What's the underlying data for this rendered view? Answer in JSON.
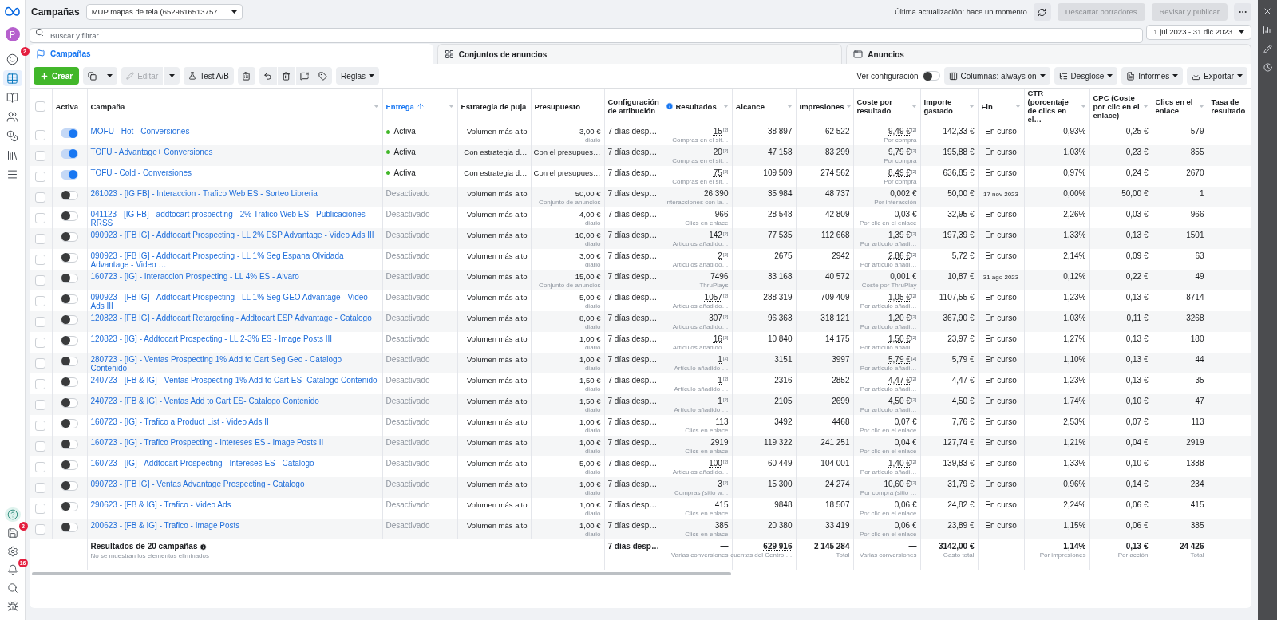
{
  "sidebar": {
    "avatar": "P",
    "items": [
      {
        "badge": "2",
        "selected": false
      },
      {
        "selected": true
      },
      {
        "selected": false
      },
      {
        "selected": false
      },
      {
        "selected": false
      },
      {
        "selected": false
      },
      {
        "selected": false
      }
    ],
    "bottom_items": [
      {
        "selected": true
      },
      {
        "badge": "2",
        "selected": false
      },
      {
        "selected": false
      },
      {
        "badge": "16",
        "selected": false
      },
      {
        "selected": false
      },
      {
        "selected": false
      }
    ]
  },
  "header": {
    "title": "Campañas",
    "account": "MUP mapas de tela (6529616513757…",
    "last_update": "Última actualización: hace un momento",
    "buttons": [
      {
        "label": "Descartar borradores",
        "disabled": true
      },
      {
        "label": "Revisar y publicar",
        "disabled": true
      }
    ]
  },
  "search": {
    "placeholder": "Buscar y filtrar"
  },
  "date_range": "1 jul 2023 - 31 dic 2023",
  "tabs": [
    {
      "label": "Campañas",
      "selected": true
    },
    {
      "label": "Conjuntos de anuncios",
      "selected": false
    },
    {
      "label": "Anuncios",
      "selected": false
    }
  ],
  "toolbar": {
    "create": "Crear",
    "edit": {
      "label": "Editar",
      "disabled": true
    },
    "ab_test": "Test A/B",
    "rules": "Reglas",
    "view_setup": "Ver configuración",
    "view_setup_on": false,
    "columns": "Columnas: always on",
    "breakdown": "Desglose",
    "reports": "Informes",
    "export": "Exportar"
  },
  "table": {
    "select_all_checked": false,
    "columns": [
      {
        "label": "Activa",
        "menu": false
      },
      {
        "label": "Campaña",
        "menu": true
      },
      {
        "label": "Entrega",
        "menu": true,
        "sorted": true
      },
      {
        "label": "Estrategia de puja",
        "menu": false
      },
      {
        "label": "Presupuesto",
        "menu": false
      },
      {
        "label": "Configuración de atribución",
        "menu": false
      },
      {
        "label": "Resultados",
        "menu": true,
        "info": true
      },
      {
        "label": "Alcance",
        "menu": true
      },
      {
        "label": "Impresiones",
        "menu": true
      },
      {
        "label": "Coste por resultado",
        "menu": true
      },
      {
        "label": "Importe gastado",
        "menu": true
      },
      {
        "label": "Fin",
        "menu": true
      },
      {
        "label": "CTR (porcentaje de clics en el…",
        "menu": true
      },
      {
        "label": "CPC (Coste por clic en el enlace)",
        "menu": true
      },
      {
        "label": "Clics en el enlace",
        "menu": true
      },
      {
        "label": "Tasa de resultado",
        "menu": false
      }
    ],
    "rows": [
      {
        "checked": false,
        "on": true,
        "name": "MOFU - Hot - Conversiones",
        "delivery": "Activa",
        "delivery_active": true,
        "strategy": "Volumen más alto",
        "budget": {
          "value": "3,00 €",
          "note": "diario"
        },
        "attribution": "7 días desp…",
        "results": {
          "value": "15",
          "mark": "[2]",
          "note": "Compras en el sit…"
        },
        "reach": "38 897",
        "impressions": "62 522",
        "cost": {
          "value": "9,49 €",
          "mark": "[2]",
          "note": "Por compra"
        },
        "spent": "142,33 €",
        "end": "En curso",
        "ctr": "0,93%",
        "cpc": "0,25 €",
        "clicks": "579"
      },
      {
        "checked": false,
        "on": true,
        "name": "TOFU - Advantage+ Conversiones",
        "delivery": "Activa",
        "delivery_active": true,
        "strategy": "Con estrategia d…",
        "budget": {
          "value": "Con el presupues…"
        },
        "attribution": "7 días desp…",
        "results": {
          "value": "20",
          "mark": "[2]",
          "note": "Compras en el sit…"
        },
        "reach": "47 158",
        "impressions": "83 299",
        "cost": {
          "value": "9,79 €",
          "mark": "[2]",
          "note": "Por compra"
        },
        "spent": "195,88 €",
        "end": "En curso",
        "ctr": "1,03%",
        "cpc": "0,23 €",
        "clicks": "855"
      },
      {
        "checked": false,
        "on": true,
        "name": "TOFU - Cold - Conversiones",
        "delivery": "Activa",
        "delivery_active": true,
        "strategy": "Con estrategia d…",
        "budget": {
          "value": "Con el presupues…"
        },
        "attribution": "7 días desp…",
        "results": {
          "value": "75",
          "mark": "[2]",
          "note": "Compras en el sit…"
        },
        "reach": "109 509",
        "impressions": "274 562",
        "cost": {
          "value": "8,49 €",
          "mark": "[2]",
          "note": "Por compra"
        },
        "spent": "636,85 €",
        "end": "En curso",
        "ctr": "0,97%",
        "cpc": "0,24 €",
        "clicks": "2670"
      },
      {
        "checked": false,
        "on": false,
        "name": "261023 - [IG FB] - Interaccion - Trafico Web ES - Sorteo Libreria",
        "delivery": "Desactivado",
        "delivery_active": false,
        "strategy": "Volumen más alto",
        "budget": {
          "value": "50,00 €",
          "note": "Conjunto de anuncios"
        },
        "attribution": "7 días desp…",
        "results": {
          "value": "26 390",
          "note": "Interacciones con la…"
        },
        "reach": "35 984",
        "impressions": "48 737",
        "cost": {
          "value": "0,002 €",
          "note": "Por interacción"
        },
        "spent": "50,00 €",
        "end": "17 nov 2023",
        "ctr": "0,00%",
        "cpc": "50,00 €",
        "clicks": "1"
      },
      {
        "checked": false,
        "on": false,
        "name": "041123 - [IG FB] - addtocart prospecting - 2% Trafico Web ES - Publicaciones RRSS",
        "delivery": "Desactivado",
        "delivery_active": false,
        "strategy": "Volumen más alto",
        "budget": {
          "value": "4,00 €",
          "note": "diario"
        },
        "attribution": "7 días desp…",
        "results": {
          "value": "966",
          "note": "Clics en enlace"
        },
        "reach": "28 548",
        "impressions": "42 809",
        "cost": {
          "value": "0,03 €",
          "note": "Por clic en el enlace"
        },
        "spent": "32,95 €",
        "end": "En curso",
        "ctr": "2,26%",
        "cpc": "0,03 €",
        "clicks": "966"
      },
      {
        "checked": false,
        "on": false,
        "name": "090923 - [FB IG] - Addtocart Prospecting - LL 2% ESP Advantage - Video Ads III",
        "delivery": "Desactivado",
        "delivery_active": false,
        "strategy": "Volumen más alto",
        "budget": {
          "value": "10,00 €",
          "note": "diario"
        },
        "attribution": "7 días desp…",
        "results": {
          "value": "142",
          "mark": "[2]",
          "note": "Artículos añadido…"
        },
        "reach": "77 535",
        "impressions": "112 668",
        "cost": {
          "value": "1,39 €",
          "mark": "[2]",
          "note": "Por artículo añadi…"
        },
        "spent": "197,39 €",
        "end": "En curso",
        "ctr": "1,33%",
        "cpc": "0,13 €",
        "clicks": "1501"
      },
      {
        "checked": false,
        "on": false,
        "name": "090923 - [FB IG] - Addtocart Prospecting - LL 1% Seg Espana Olvidada Advantage - Video …",
        "delivery": "Desactivado",
        "delivery_active": false,
        "strategy": "Volumen más alto",
        "budget": {
          "value": "3,00 €",
          "note": "diario"
        },
        "attribution": "7 días desp…",
        "results": {
          "value": "2",
          "mark": "[2]",
          "note": "Artículos añadido…"
        },
        "reach": "2675",
        "impressions": "2942",
        "cost": {
          "value": "2,86 €",
          "mark": "[2]",
          "note": "Por artículo añadi…"
        },
        "spent": "5,72 €",
        "end": "En curso",
        "ctr": "2,14%",
        "cpc": "0,09 €",
        "clicks": "63"
      },
      {
        "checked": false,
        "on": false,
        "name": "160723 - [IG] - Interaccion Prospecting - LL 4% ES - Alvaro",
        "delivery": "Desactivado",
        "delivery_active": false,
        "strategy": "Volumen más alto",
        "budget": {
          "value": "15,00 €",
          "note": "Conjunto de anuncios"
        },
        "attribution": "7 días desp…",
        "results": {
          "value": "7496",
          "note": "ThruPlays"
        },
        "reach": "33 168",
        "impressions": "40 572",
        "cost": {
          "value": "0,001 €",
          "note": "Coste por ThruPlay"
        },
        "spent": "10,87 €",
        "end": "31 ago 2023",
        "ctr": "0,12%",
        "cpc": "0,22 €",
        "clicks": "49"
      },
      {
        "checked": false,
        "on": false,
        "name": "090923 - [FB IG] - Addtocart Prospecting - LL 1% Seg GEO Advantage - Video Ads III",
        "delivery": "Desactivado",
        "delivery_active": false,
        "strategy": "Volumen más alto",
        "budget": {
          "value": "5,00 €",
          "note": "diario"
        },
        "attribution": "7 días desp…",
        "results": {
          "value": "1057",
          "mark": "[2]",
          "note": "Artículos añadido…"
        },
        "reach": "288 319",
        "impressions": "709 409",
        "cost": {
          "value": "1,05 €",
          "mark": "[2]",
          "note": "Por artículo añadi…"
        },
        "spent": "1107,55 €",
        "end": "En curso",
        "ctr": "1,23%",
        "cpc": "0,13 €",
        "clicks": "8714"
      },
      {
        "checked": false,
        "on": false,
        "name": "120823 - [FB IG] - Addtocart Retargeting - Addtocart ESP Advantage - Catalogo",
        "delivery": "Desactivado",
        "delivery_active": false,
        "strategy": "Volumen más alto",
        "budget": {
          "value": "8,00 €",
          "note": "diario"
        },
        "attribution": "7 días desp…",
        "results": {
          "value": "307",
          "mark": "[2]",
          "note": "Artículos añadido…"
        },
        "reach": "96 363",
        "impressions": "318 121",
        "cost": {
          "value": "1,20 €",
          "mark": "[2]",
          "note": "Por artículo añadi…"
        },
        "spent": "367,90 €",
        "end": "En curso",
        "ctr": "1,03%",
        "cpc": "0,11 €",
        "clicks": "3268"
      },
      {
        "checked": false,
        "on": false,
        "name": "120823 - [IG] - Addtocart Prospecting - LL 2-3% ES - Image Posts III",
        "delivery": "Desactivado",
        "delivery_active": false,
        "strategy": "Volumen más alto",
        "budget": {
          "value": "1,00 €",
          "note": "diario"
        },
        "attribution": "7 días desp…",
        "results": {
          "value": "16",
          "mark": "[2]",
          "note": "Artículos añadido…"
        },
        "reach": "10 840",
        "impressions": "14 175",
        "cost": {
          "value": "1,50 €",
          "mark": "[2]",
          "note": "Por artículo añadi…"
        },
        "spent": "23,97 €",
        "end": "En curso",
        "ctr": "1,27%",
        "cpc": "0,13 €",
        "clicks": "180"
      },
      {
        "checked": false,
        "on": false,
        "name": "280723 - [IG] - Ventas Prospecting 1% Add to Cart Seg Geo - Catalogo Contenido",
        "delivery": "Desactivado",
        "delivery_active": false,
        "strategy": "Volumen más alto",
        "budget": {
          "value": "1,00 €",
          "note": "diario"
        },
        "attribution": "7 días desp…",
        "results": {
          "value": "1",
          "mark": "[2]",
          "note": "Artículo añadido …"
        },
        "reach": "3151",
        "impressions": "3997",
        "cost": {
          "value": "5,79 €",
          "mark": "[2]",
          "note": "Por artículo añadi…"
        },
        "spent": "5,79 €",
        "end": "En curso",
        "ctr": "1,10%",
        "cpc": "0,13 €",
        "clicks": "44"
      },
      {
        "checked": false,
        "on": false,
        "name": "240723 - [FB & IG] - Ventas Prospecting 1% Add to Cart ES- Catalogo Contenido",
        "delivery": "Desactivado",
        "delivery_active": false,
        "strategy": "Volumen más alto",
        "budget": {
          "value": "1,50 €",
          "note": "diario"
        },
        "attribution": "7 días desp…",
        "results": {
          "value": "1",
          "mark": "[2]",
          "note": "Artículo añadido …"
        },
        "reach": "2316",
        "impressions": "2852",
        "cost": {
          "value": "4,47 €",
          "mark": "[2]",
          "note": "Por artículo añadi…"
        },
        "spent": "4,47 €",
        "end": "En curso",
        "ctr": "1,23%",
        "cpc": "0,13 €",
        "clicks": "35"
      },
      {
        "checked": false,
        "on": false,
        "name": "240723 - [FB & IG] - Ventas Add to Cart ES- Catalogo Contenido",
        "delivery": "Desactivado",
        "delivery_active": false,
        "strategy": "Volumen más alto",
        "budget": {
          "value": "1,50 €",
          "note": "diario"
        },
        "attribution": "7 días desp…",
        "results": {
          "value": "1",
          "mark": "[2]",
          "note": "Artículo añadido …"
        },
        "reach": "2105",
        "impressions": "2699",
        "cost": {
          "value": "4,50 €",
          "mark": "[2]",
          "note": "Por artículo añadi…"
        },
        "spent": "4,50 €",
        "end": "En curso",
        "ctr": "1,74%",
        "cpc": "0,10 €",
        "clicks": "47"
      },
      {
        "checked": false,
        "on": false,
        "name": "160723 - [IG] - Trafico a Product List - Video Ads II",
        "delivery": "Desactivado",
        "delivery_active": false,
        "strategy": "Volumen más alto",
        "budget": {
          "value": "1,00 €",
          "note": "diario"
        },
        "attribution": "7 días desp…",
        "results": {
          "value": "113",
          "note": "Clics en enlace"
        },
        "reach": "3492",
        "impressions": "4468",
        "cost": {
          "value": "0,07 €",
          "note": "Por clic en el enlace"
        },
        "spent": "7,76 €",
        "end": "En curso",
        "ctr": "2,53%",
        "cpc": "0,07 €",
        "clicks": "113"
      },
      {
        "checked": false,
        "on": false,
        "name": "160723 - [IG] - Trafico Prospecting - Intereses ES - Image Posts II",
        "delivery": "Desactivado",
        "delivery_active": false,
        "strategy": "Volumen más alto",
        "budget": {
          "value": "1,00 €",
          "note": "diario"
        },
        "attribution": "7 días desp…",
        "results": {
          "value": "2919",
          "note": "Clics en enlace"
        },
        "reach": "119 322",
        "impressions": "241 251",
        "cost": {
          "value": "0,04 €",
          "note": "Por clic en el enlace"
        },
        "spent": "127,74 €",
        "end": "En curso",
        "ctr": "1,21%",
        "cpc": "0,04 €",
        "clicks": "2919"
      },
      {
        "checked": false,
        "on": false,
        "name": "160723 - [IG] - Addtocart Prospecting - Intereses ES - Catalogo",
        "delivery": "Desactivado",
        "delivery_active": false,
        "strategy": "Volumen más alto",
        "budget": {
          "value": "5,00 €",
          "note": "diario"
        },
        "attribution": "7 días desp…",
        "results": {
          "value": "100",
          "mark": "[2]",
          "note": "Artículos añadido…"
        },
        "reach": "60 449",
        "impressions": "104 001",
        "cost": {
          "value": "1,40 €",
          "mark": "[2]",
          "note": "Por artículo añadi…"
        },
        "spent": "139,83 €",
        "end": "En curso",
        "ctr": "1,33%",
        "cpc": "0,10 €",
        "clicks": "1388"
      },
      {
        "checked": false,
        "on": false,
        "name": "090723 - [FB IG] - Ventas Advantage Prospecting - Catalogo",
        "delivery": "Desactivado",
        "delivery_active": false,
        "strategy": "Volumen más alto",
        "budget": {
          "value": "1,00 €",
          "note": "diario"
        },
        "attribution": "7 días desp…",
        "results": {
          "value": "3",
          "mark": "[2]",
          "note": "Compras (sitio w…"
        },
        "reach": "15 300",
        "impressions": "24 274",
        "cost": {
          "value": "10,60 €",
          "mark": "[2]",
          "note": "Por compra (sitio …"
        },
        "spent": "31,79 €",
        "end": "En curso",
        "ctr": "0,96%",
        "cpc": "0,14 €",
        "clicks": "234"
      },
      {
        "checked": false,
        "on": false,
        "name": "290623 - [FB & IG] - Trafico - Video Ads",
        "delivery": "Desactivado",
        "delivery_active": false,
        "strategy": "Volumen más alto",
        "budget": {
          "value": "1,00 €",
          "note": "diario"
        },
        "attribution": "7 días desp…",
        "results": {
          "value": "415",
          "note": "Clics en enlace"
        },
        "reach": "9848",
        "impressions": "18 507",
        "cost": {
          "value": "0,06 €",
          "note": "Por clic en el enlace"
        },
        "spent": "24,82 €",
        "end": "En curso",
        "ctr": "2,24%",
        "cpc": "0,06 €",
        "clicks": "415"
      },
      {
        "checked": false,
        "on": false,
        "name": "200623 - [FB & IG] - Trafico - Image Posts",
        "delivery": "Desactivado",
        "delivery_active": false,
        "strategy": "Volumen más alto",
        "budget": {
          "value": "1,00 €",
          "note": "diario"
        },
        "attribution": "7 días desp…",
        "results": {
          "value": "385",
          "note": "Clics en enlace"
        },
        "reach": "20 380",
        "impressions": "33 419",
        "cost": {
          "value": "0,06 €",
          "note": "Por clic en el enlace"
        },
        "spent": "23,89 €",
        "end": "En curso",
        "ctr": "1,15%",
        "cpc": "0,06 €",
        "clicks": "385"
      }
    ],
    "totals": {
      "title": "Resultados de 20 campañas",
      "subtitle": "No se muestran los elementos eliminados",
      "attribution": "7 días desp…",
      "results": {
        "value": "—",
        "note": "Varias conversiones"
      },
      "reach": {
        "value": "629 916",
        "note": "cuentas del Centro …"
      },
      "impressions": {
        "value": "2 145 284",
        "note": "Total"
      },
      "cost": {
        "value": "—",
        "note": "Varias conversiones"
      },
      "spent": {
        "value": "3142,00 €",
        "note": "Gasto total"
      },
      "ctr": {
        "value": "1,14%",
        "note": "Por impresiones"
      },
      "cpc": {
        "value": "0,13 €",
        "note": "Por acción"
      },
      "clicks": {
        "value": "24 426",
        "note": "Total"
      }
    }
  }
}
